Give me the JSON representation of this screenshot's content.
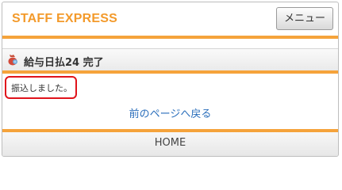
{
  "header": {
    "brand": "STAFF EXPRESS",
    "menu_label": "メニュー"
  },
  "title": {
    "icon": "coin-bag-icon",
    "text": "給与日払24 完了"
  },
  "message": "振込しました。",
  "back_link": "前のページへ戻る",
  "footer": {
    "home_label": "HOME"
  },
  "colors": {
    "brand": "#f39a2b",
    "accent_bar": "#f5a33b",
    "highlight": "#e0131b",
    "link": "#2a6ebb"
  }
}
